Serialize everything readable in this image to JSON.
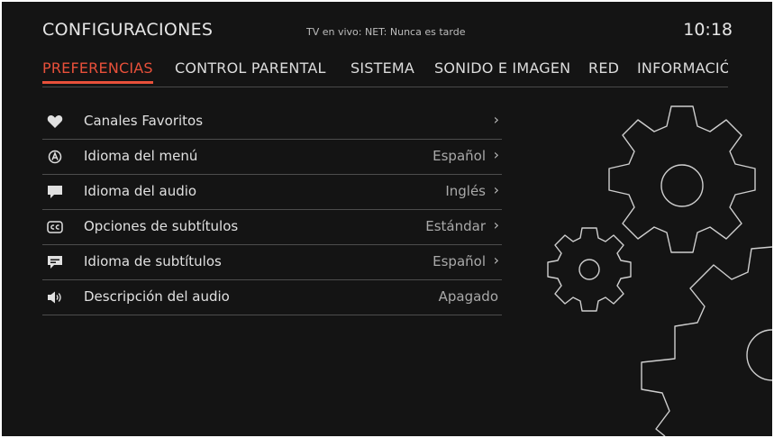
{
  "header": {
    "title": "CONFIGURACIONES",
    "live": "TV en vivo: NET: Nunca es tarde",
    "time": "10:18"
  },
  "tabs": [
    {
      "label": "PREFERENCIAS",
      "active": true
    },
    {
      "label": "CONTROL PARENTAL"
    },
    {
      "label": "SISTEMA"
    },
    {
      "label": "SONIDO E IMAGEN"
    },
    {
      "label": "RED"
    },
    {
      "label": "INFORMACIÓN"
    }
  ],
  "menu": [
    {
      "icon": "heart-icon",
      "label": "Canales Favoritos",
      "value": "",
      "chevron": "›"
    },
    {
      "icon": "language-icon",
      "label": "Idioma del menú",
      "value": "Español",
      "chevron": "›"
    },
    {
      "icon": "speech-bubble-icon",
      "label": "Idioma del audio",
      "value": "Inglés",
      "chevron": "›"
    },
    {
      "icon": "closed-caption-icon",
      "label": "Opciones de subtítulos",
      "value": "Estándar",
      "chevron": "›"
    },
    {
      "icon": "subtitle-bubble-icon",
      "label": "Idioma de subtítulos",
      "value": "Español",
      "chevron": "›"
    },
    {
      "icon": "speaker-icon",
      "label": "Descripción del audio",
      "value": "Apagado",
      "chevron": ""
    }
  ],
  "colors": {
    "accent": "#e8503a",
    "background": "#141414"
  },
  "decoration": "gears-icon"
}
